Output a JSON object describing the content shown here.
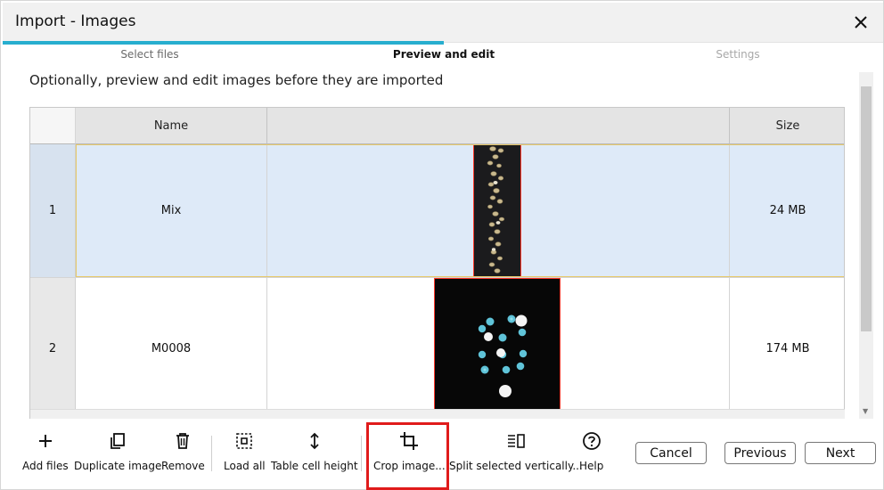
{
  "window": {
    "title": "Import - Images",
    "close_icon": "close-icon"
  },
  "wizard": {
    "steps": [
      "Select files",
      "Preview and edit",
      "Settings"
    ],
    "active_step": 2,
    "progress_fraction": 0.5
  },
  "instruction": "Optionally, preview and edit images before they are imported",
  "table": {
    "columns": [
      "",
      "Name",
      "",
      "Size"
    ],
    "rows": [
      {
        "index": "1",
        "name": "Mix",
        "size": "24 MB",
        "selected": true
      },
      {
        "index": "2",
        "name": "M0008",
        "size": "174 MB",
        "selected": false
      }
    ]
  },
  "toolbar": {
    "add_files": "Add files",
    "duplicate_image": "Duplicate image",
    "remove": "Remove",
    "load_all": "Load all",
    "table_cell_height": "Table cell height",
    "crop_image": "Crop image...",
    "split_vertically": "Split selected vertically...",
    "help": "Help"
  },
  "buttons": {
    "cancel": "Cancel",
    "previous": "Previous",
    "next": "Next"
  },
  "colors": {
    "progress": "#27aecf",
    "selected_row": "#deeaf8",
    "selection_outline": "#e7c96a",
    "highlight": "#e01b1b"
  }
}
